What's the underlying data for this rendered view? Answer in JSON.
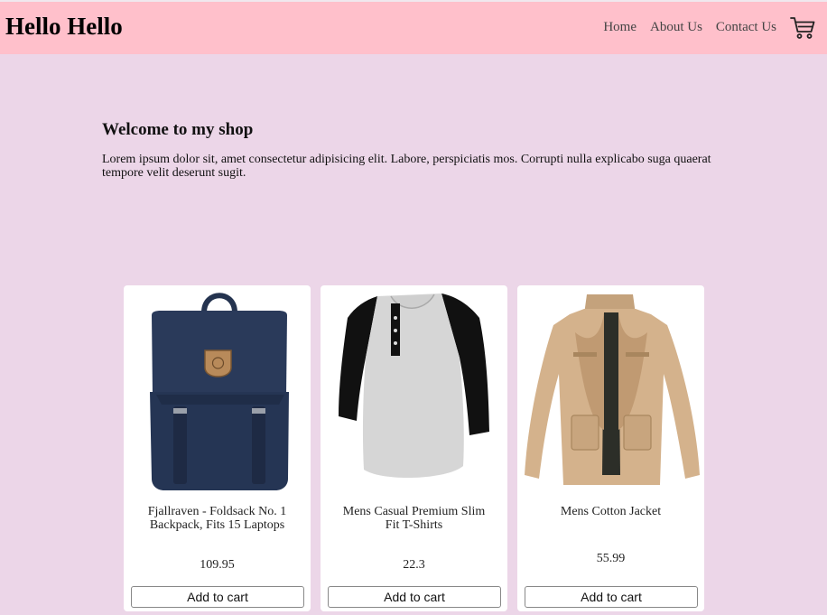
{
  "header": {
    "brand": "Hello Hello",
    "nav": [
      {
        "label": "Home"
      },
      {
        "label": "About Us"
      },
      {
        "label": "Contact Us"
      }
    ],
    "cart_icon": "shopping-cart-icon"
  },
  "hero": {
    "heading": "Welcome to my shop",
    "text": "Lorem ipsum dolor sit, amet consectetur adipisicing elit. Labore, perspiciatis mos. Corrupti nulla explicabo suga quaerat tempore velit deserunt sugit."
  },
  "products": [
    {
      "title": "Fjallraven - Foldsack No. 1 Backpack, Fits 15 Laptops",
      "price": "109.95",
      "button": "Add to cart"
    },
    {
      "title": "Mens Casual Premium Slim Fit T-Shirts",
      "price": "22.3",
      "button": "Add to cart"
    },
    {
      "title": "Mens Cotton Jacket",
      "price": "55.99",
      "button": "Add to cart"
    }
  ],
  "colors": {
    "page_bg": "#ecd6e8",
    "header_bg": "#ffc0cb",
    "card_bg": "#ffffff"
  }
}
